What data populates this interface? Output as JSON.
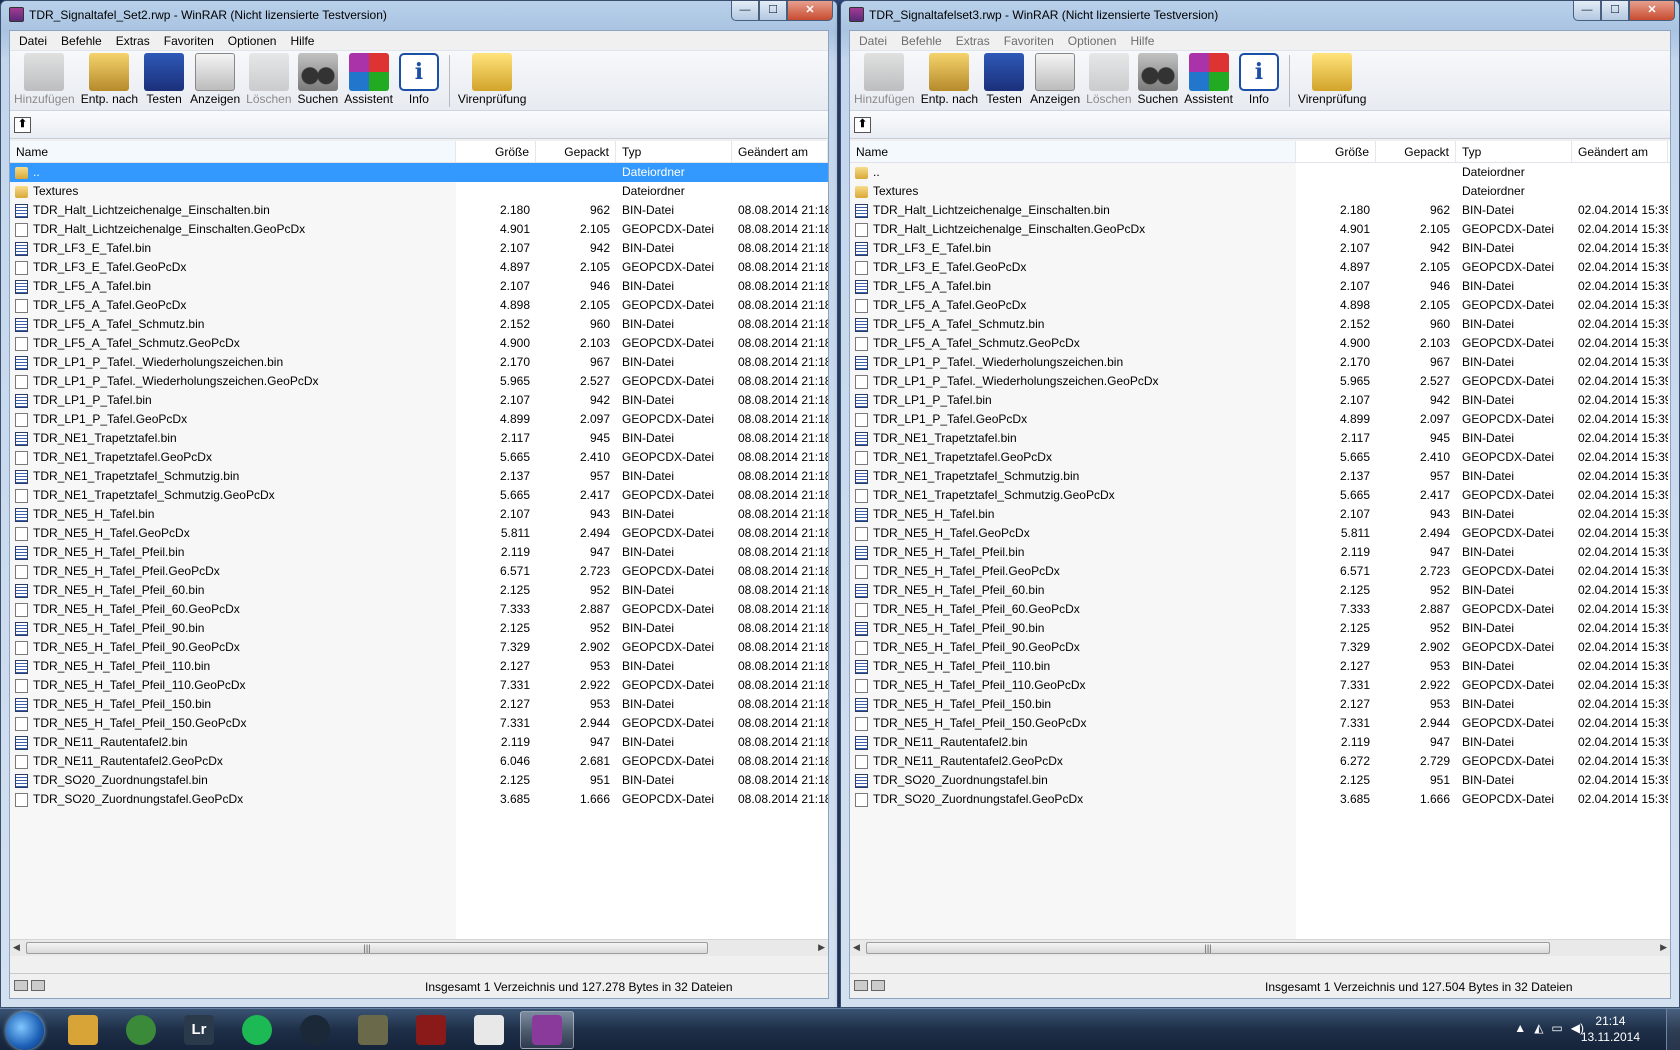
{
  "menu": [
    "Datei",
    "Befehle",
    "Extras",
    "Favoriten",
    "Optionen",
    "Hilfe"
  ],
  "toolbar": [
    {
      "label": "Hinzufügen",
      "icon": "add-archive-icon",
      "disabled": true,
      "cls": "ico-add"
    },
    {
      "label": "Entp. nach",
      "icon": "extract-to-icon",
      "disabled": false,
      "cls": "ico-extract"
    },
    {
      "label": "Testen",
      "icon": "test-icon",
      "disabled": false,
      "cls": "ico-test"
    },
    {
      "label": "Anzeigen",
      "icon": "view-icon",
      "disabled": false,
      "cls": "ico-view"
    },
    {
      "label": "Löschen",
      "icon": "delete-icon",
      "disabled": true,
      "cls": "ico-del"
    },
    {
      "label": "Suchen",
      "icon": "find-binoculars-icon",
      "disabled": false,
      "cls": "ico-find"
    },
    {
      "label": "Assistent",
      "icon": "wizard-icon",
      "disabled": false,
      "cls": "ico-wiz"
    },
    {
      "label": "Info",
      "icon": "info-icon",
      "disabled": false,
      "cls": "ico-info"
    }
  ],
  "toolbar_extra": {
    "label": "Virenprüfung",
    "icon": "virus-scan-icon"
  },
  "columns": {
    "name": "Name",
    "size": "Größe",
    "packed": "Gepackt",
    "type": "Typ",
    "modified": "Geändert am"
  },
  "window_buttons": {
    "minimize": "—",
    "maximize": "☐",
    "close": "✕"
  },
  "windows": [
    {
      "title": "TDR_Signaltafel_Set2.rwp - WinRAR (Nicht lizensierte Testversion)",
      "menu_disabled": false,
      "status": "Insgesamt 1 Verzeichnis und 127.278 Bytes in 32 Dateien",
      "rows": [
        {
          "name": "..",
          "size": "",
          "packed": "",
          "type": "Dateiordner",
          "date": "",
          "kind": "folder",
          "selected": true
        },
        {
          "name": "Textures",
          "size": "",
          "packed": "",
          "type": "Dateiordner",
          "date": "",
          "kind": "folder"
        },
        {
          "name": "TDR_Halt_Lichtzeichenalge_Einschalten.bin",
          "size": "2.180",
          "packed": "962",
          "type": "BIN-Datei",
          "date": "08.08.2014 21:18",
          "kind": "bin"
        },
        {
          "name": "TDR_Halt_Lichtzeichenalge_Einschalten.GeoPcDx",
          "size": "4.901",
          "packed": "2.105",
          "type": "GEOPCDX-Datei",
          "date": "08.08.2014 21:18",
          "kind": "file"
        },
        {
          "name": "TDR_LF3_E_Tafel.bin",
          "size": "2.107",
          "packed": "942",
          "type": "BIN-Datei",
          "date": "08.08.2014 21:18",
          "kind": "bin"
        },
        {
          "name": "TDR_LF3_E_Tafel.GeoPcDx",
          "size": "4.897",
          "packed": "2.105",
          "type": "GEOPCDX-Datei",
          "date": "08.08.2014 21:18",
          "kind": "file"
        },
        {
          "name": "TDR_LF5_A_Tafel.bin",
          "size": "2.107",
          "packed": "946",
          "type": "BIN-Datei",
          "date": "08.08.2014 21:18",
          "kind": "bin"
        },
        {
          "name": "TDR_LF5_A_Tafel.GeoPcDx",
          "size": "4.898",
          "packed": "2.105",
          "type": "GEOPCDX-Datei",
          "date": "08.08.2014 21:18",
          "kind": "file"
        },
        {
          "name": "TDR_LF5_A_Tafel_Schmutz.bin",
          "size": "2.152",
          "packed": "960",
          "type": "BIN-Datei",
          "date": "08.08.2014 21:18",
          "kind": "bin"
        },
        {
          "name": "TDR_LF5_A_Tafel_Schmutz.GeoPcDx",
          "size": "4.900",
          "packed": "2.103",
          "type": "GEOPCDX-Datei",
          "date": "08.08.2014 21:18",
          "kind": "file"
        },
        {
          "name": "TDR_LP1_P_Tafel._Wiederholungszeichen.bin",
          "size": "2.170",
          "packed": "967",
          "type": "BIN-Datei",
          "date": "08.08.2014 21:18",
          "kind": "bin"
        },
        {
          "name": "TDR_LP1_P_Tafel._Wiederholungszeichen.GeoPcDx",
          "size": "5.965",
          "packed": "2.527",
          "type": "GEOPCDX-Datei",
          "date": "08.08.2014 21:18",
          "kind": "file"
        },
        {
          "name": "TDR_LP1_P_Tafel.bin",
          "size": "2.107",
          "packed": "942",
          "type": "BIN-Datei",
          "date": "08.08.2014 21:18",
          "kind": "bin"
        },
        {
          "name": "TDR_LP1_P_Tafel.GeoPcDx",
          "size": "4.899",
          "packed": "2.097",
          "type": "GEOPCDX-Datei",
          "date": "08.08.2014 21:18",
          "kind": "file"
        },
        {
          "name": "TDR_NE1_Trapetztafel.bin",
          "size": "2.117",
          "packed": "945",
          "type": "BIN-Datei",
          "date": "08.08.2014 21:18",
          "kind": "bin"
        },
        {
          "name": "TDR_NE1_Trapetztafel.GeoPcDx",
          "size": "5.665",
          "packed": "2.410",
          "type": "GEOPCDX-Datei",
          "date": "08.08.2014 21:18",
          "kind": "file"
        },
        {
          "name": "TDR_NE1_Trapetztafel_Schmutzig.bin",
          "size": "2.137",
          "packed": "957",
          "type": "BIN-Datei",
          "date": "08.08.2014 21:18",
          "kind": "bin"
        },
        {
          "name": "TDR_NE1_Trapetztafel_Schmutzig.GeoPcDx",
          "size": "5.665",
          "packed": "2.417",
          "type": "GEOPCDX-Datei",
          "date": "08.08.2014 21:18",
          "kind": "file"
        },
        {
          "name": "TDR_NE5_H_Tafel.bin",
          "size": "2.107",
          "packed": "943",
          "type": "BIN-Datei",
          "date": "08.08.2014 21:18",
          "kind": "bin"
        },
        {
          "name": "TDR_NE5_H_Tafel.GeoPcDx",
          "size": "5.811",
          "packed": "2.494",
          "type": "GEOPCDX-Datei",
          "date": "08.08.2014 21:18",
          "kind": "file"
        },
        {
          "name": "TDR_NE5_H_Tafel_Pfeil.bin",
          "size": "2.119",
          "packed": "947",
          "type": "BIN-Datei",
          "date": "08.08.2014 21:18",
          "kind": "bin"
        },
        {
          "name": "TDR_NE5_H_Tafel_Pfeil.GeoPcDx",
          "size": "6.571",
          "packed": "2.723",
          "type": "GEOPCDX-Datei",
          "date": "08.08.2014 21:18",
          "kind": "file"
        },
        {
          "name": "TDR_NE5_H_Tafel_Pfeil_60.bin",
          "size": "2.125",
          "packed": "952",
          "type": "BIN-Datei",
          "date": "08.08.2014 21:18",
          "kind": "bin"
        },
        {
          "name": "TDR_NE5_H_Tafel_Pfeil_60.GeoPcDx",
          "size": "7.333",
          "packed": "2.887",
          "type": "GEOPCDX-Datei",
          "date": "08.08.2014 21:18",
          "kind": "file"
        },
        {
          "name": "TDR_NE5_H_Tafel_Pfeil_90.bin",
          "size": "2.125",
          "packed": "952",
          "type": "BIN-Datei",
          "date": "08.08.2014 21:18",
          "kind": "bin"
        },
        {
          "name": "TDR_NE5_H_Tafel_Pfeil_90.GeoPcDx",
          "size": "7.329",
          "packed": "2.902",
          "type": "GEOPCDX-Datei",
          "date": "08.08.2014 21:18",
          "kind": "file"
        },
        {
          "name": "TDR_NE5_H_Tafel_Pfeil_110.bin",
          "size": "2.127",
          "packed": "953",
          "type": "BIN-Datei",
          "date": "08.08.2014 21:18",
          "kind": "bin"
        },
        {
          "name": "TDR_NE5_H_Tafel_Pfeil_110.GeoPcDx",
          "size": "7.331",
          "packed": "2.922",
          "type": "GEOPCDX-Datei",
          "date": "08.08.2014 21:18",
          "kind": "file"
        },
        {
          "name": "TDR_NE5_H_Tafel_Pfeil_150.bin",
          "size": "2.127",
          "packed": "953",
          "type": "BIN-Datei",
          "date": "08.08.2014 21:18",
          "kind": "bin"
        },
        {
          "name": "TDR_NE5_H_Tafel_Pfeil_150.GeoPcDx",
          "size": "7.331",
          "packed": "2.944",
          "type": "GEOPCDX-Datei",
          "date": "08.08.2014 21:18",
          "kind": "file"
        },
        {
          "name": "TDR_NE11_Rautentafel2.bin",
          "size": "2.119",
          "packed": "947",
          "type": "BIN-Datei",
          "date": "08.08.2014 21:18",
          "kind": "bin"
        },
        {
          "name": "TDR_NE11_Rautentafel2.GeoPcDx",
          "size": "6.046",
          "packed": "2.681",
          "type": "GEOPCDX-Datei",
          "date": "08.08.2014 21:18",
          "kind": "file"
        },
        {
          "name": "TDR_SO20_Zuordnungstafel.bin",
          "size": "2.125",
          "packed": "951",
          "type": "BIN-Datei",
          "date": "08.08.2014 21:18",
          "kind": "bin"
        },
        {
          "name": "TDR_SO20_Zuordnungstafel.GeoPcDx",
          "size": "3.685",
          "packed": "1.666",
          "type": "GEOPCDX-Datei",
          "date": "08.08.2014 21:18",
          "kind": "file"
        }
      ]
    },
    {
      "title": "TDR_Signaltafelset3.rwp - WinRAR (Nicht lizensierte Testversion)",
      "menu_disabled": true,
      "status": "Insgesamt 1 Verzeichnis und 127.504 Bytes in 32 Dateien",
      "rows": [
        {
          "name": "..",
          "size": "",
          "packed": "",
          "type": "Dateiordner",
          "date": "",
          "kind": "folder"
        },
        {
          "name": "Textures",
          "size": "",
          "packed": "",
          "type": "Dateiordner",
          "date": "",
          "kind": "folder"
        },
        {
          "name": "TDR_Halt_Lichtzeichenalge_Einschalten.bin",
          "size": "2.180",
          "packed": "962",
          "type": "BIN-Datei",
          "date": "02.04.2014 15:39",
          "kind": "bin"
        },
        {
          "name": "TDR_Halt_Lichtzeichenalge_Einschalten.GeoPcDx",
          "size": "4.901",
          "packed": "2.105",
          "type": "GEOPCDX-Datei",
          "date": "02.04.2014 15:39",
          "kind": "file"
        },
        {
          "name": "TDR_LF3_E_Tafel.bin",
          "size": "2.107",
          "packed": "942",
          "type": "BIN-Datei",
          "date": "02.04.2014 15:39",
          "kind": "bin"
        },
        {
          "name": "TDR_LF3_E_Tafel.GeoPcDx",
          "size": "4.897",
          "packed": "2.105",
          "type": "GEOPCDX-Datei",
          "date": "02.04.2014 15:39",
          "kind": "file"
        },
        {
          "name": "TDR_LF5_A_Tafel.bin",
          "size": "2.107",
          "packed": "946",
          "type": "BIN-Datei",
          "date": "02.04.2014 15:39",
          "kind": "bin"
        },
        {
          "name": "TDR_LF5_A_Tafel.GeoPcDx",
          "size": "4.898",
          "packed": "2.105",
          "type": "GEOPCDX-Datei",
          "date": "02.04.2014 15:39",
          "kind": "file"
        },
        {
          "name": "TDR_LF5_A_Tafel_Schmutz.bin",
          "size": "2.152",
          "packed": "960",
          "type": "BIN-Datei",
          "date": "02.04.2014 15:39",
          "kind": "bin"
        },
        {
          "name": "TDR_LF5_A_Tafel_Schmutz.GeoPcDx",
          "size": "4.900",
          "packed": "2.103",
          "type": "GEOPCDX-Datei",
          "date": "02.04.2014 15:39",
          "kind": "file"
        },
        {
          "name": "TDR_LP1_P_Tafel._Wiederholungszeichen.bin",
          "size": "2.170",
          "packed": "967",
          "type": "BIN-Datei",
          "date": "02.04.2014 15:39",
          "kind": "bin"
        },
        {
          "name": "TDR_LP1_P_Tafel._Wiederholungszeichen.GeoPcDx",
          "size": "5.965",
          "packed": "2.527",
          "type": "GEOPCDX-Datei",
          "date": "02.04.2014 15:39",
          "kind": "file"
        },
        {
          "name": "TDR_LP1_P_Tafel.bin",
          "size": "2.107",
          "packed": "942",
          "type": "BIN-Datei",
          "date": "02.04.2014 15:39",
          "kind": "bin"
        },
        {
          "name": "TDR_LP1_P_Tafel.GeoPcDx",
          "size": "4.899",
          "packed": "2.097",
          "type": "GEOPCDX-Datei",
          "date": "02.04.2014 15:39",
          "kind": "file"
        },
        {
          "name": "TDR_NE1_Trapetztafel.bin",
          "size": "2.117",
          "packed": "945",
          "type": "BIN-Datei",
          "date": "02.04.2014 15:39",
          "kind": "bin"
        },
        {
          "name": "TDR_NE1_Trapetztafel.GeoPcDx",
          "size": "5.665",
          "packed": "2.410",
          "type": "GEOPCDX-Datei",
          "date": "02.04.2014 15:39",
          "kind": "file"
        },
        {
          "name": "TDR_NE1_Trapetztafel_Schmutzig.bin",
          "size": "2.137",
          "packed": "957",
          "type": "BIN-Datei",
          "date": "02.04.2014 15:39",
          "kind": "bin"
        },
        {
          "name": "TDR_NE1_Trapetztafel_Schmutzig.GeoPcDx",
          "size": "5.665",
          "packed": "2.417",
          "type": "GEOPCDX-Datei",
          "date": "02.04.2014 15:39",
          "kind": "file"
        },
        {
          "name": "TDR_NE5_H_Tafel.bin",
          "size": "2.107",
          "packed": "943",
          "type": "BIN-Datei",
          "date": "02.04.2014 15:39",
          "kind": "bin"
        },
        {
          "name": "TDR_NE5_H_Tafel.GeoPcDx",
          "size": "5.811",
          "packed": "2.494",
          "type": "GEOPCDX-Datei",
          "date": "02.04.2014 15:39",
          "kind": "file"
        },
        {
          "name": "TDR_NE5_H_Tafel_Pfeil.bin",
          "size": "2.119",
          "packed": "947",
          "type": "BIN-Datei",
          "date": "02.04.2014 15:39",
          "kind": "bin"
        },
        {
          "name": "TDR_NE5_H_Tafel_Pfeil.GeoPcDx",
          "size": "6.571",
          "packed": "2.723",
          "type": "GEOPCDX-Datei",
          "date": "02.04.2014 15:39",
          "kind": "file"
        },
        {
          "name": "TDR_NE5_H_Tafel_Pfeil_60.bin",
          "size": "2.125",
          "packed": "952",
          "type": "BIN-Datei",
          "date": "02.04.2014 15:39",
          "kind": "bin"
        },
        {
          "name": "TDR_NE5_H_Tafel_Pfeil_60.GeoPcDx",
          "size": "7.333",
          "packed": "2.887",
          "type": "GEOPCDX-Datei",
          "date": "02.04.2014 15:39",
          "kind": "file"
        },
        {
          "name": "TDR_NE5_H_Tafel_Pfeil_90.bin",
          "size": "2.125",
          "packed": "952",
          "type": "BIN-Datei",
          "date": "02.04.2014 15:39",
          "kind": "bin"
        },
        {
          "name": "TDR_NE5_H_Tafel_Pfeil_90.GeoPcDx",
          "size": "7.329",
          "packed": "2.902",
          "type": "GEOPCDX-Datei",
          "date": "02.04.2014 15:39",
          "kind": "file"
        },
        {
          "name": "TDR_NE5_H_Tafel_Pfeil_110.bin",
          "size": "2.127",
          "packed": "953",
          "type": "BIN-Datei",
          "date": "02.04.2014 15:39",
          "kind": "bin"
        },
        {
          "name": "TDR_NE5_H_Tafel_Pfeil_110.GeoPcDx",
          "size": "7.331",
          "packed": "2.922",
          "type": "GEOPCDX-Datei",
          "date": "02.04.2014 15:39",
          "kind": "file"
        },
        {
          "name": "TDR_NE5_H_Tafel_Pfeil_150.bin",
          "size": "2.127",
          "packed": "953",
          "type": "BIN-Datei",
          "date": "02.04.2014 15:39",
          "kind": "bin"
        },
        {
          "name": "TDR_NE5_H_Tafel_Pfeil_150.GeoPcDx",
          "size": "7.331",
          "packed": "2.944",
          "type": "GEOPCDX-Datei",
          "date": "02.04.2014 15:39",
          "kind": "file"
        },
        {
          "name": "TDR_NE11_Rautentafel2.bin",
          "size": "2.119",
          "packed": "947",
          "type": "BIN-Datei",
          "date": "02.04.2014 15:39",
          "kind": "bin"
        },
        {
          "name": "TDR_NE11_Rautentafel2.GeoPcDx",
          "size": "6.272",
          "packed": "2.729",
          "type": "GEOPCDX-Datei",
          "date": "02.04.2014 15:39",
          "kind": "file"
        },
        {
          "name": "TDR_SO20_Zuordnungstafel.bin",
          "size": "2.125",
          "packed": "951",
          "type": "BIN-Datei",
          "date": "02.04.2014 15:39",
          "kind": "bin"
        },
        {
          "name": "TDR_SO20_Zuordnungstafel.GeoPcDx",
          "size": "3.685",
          "packed": "1.666",
          "type": "GEOPCDX-Datei",
          "date": "02.04.2014 15:39",
          "kind": "file"
        }
      ]
    }
  ],
  "taskbar": {
    "items": [
      {
        "name": "file-explorer",
        "icon": "folder-icon",
        "color": "#d9a437",
        "glyph": ""
      },
      {
        "name": "chrome",
        "icon": "chrome-icon",
        "color": "#3a8a3a",
        "glyph": ""
      },
      {
        "name": "lightroom",
        "icon": "lightroom-icon",
        "color": "#2b3a4a",
        "glyph": "Lr"
      },
      {
        "name": "spotify",
        "icon": "spotify-icon",
        "color": "#1db954",
        "glyph": ""
      },
      {
        "name": "steam",
        "icon": "steam-icon",
        "color": "#1b2838",
        "glyph": ""
      },
      {
        "name": "game-soldier",
        "icon": "soldier-icon",
        "color": "#6a6a4a",
        "glyph": ""
      },
      {
        "name": "game-agent",
        "icon": "agent-icon",
        "color": "#8a1a1a",
        "glyph": ""
      },
      {
        "name": "train-simulator",
        "icon": "train-icon",
        "color": "#e8e8e8",
        "glyph": ""
      },
      {
        "name": "winrar",
        "icon": "winrar-icon",
        "color": "#8a3a9a",
        "glyph": "",
        "active": true
      }
    ],
    "time": "21:14",
    "date": "13.11.2014"
  }
}
